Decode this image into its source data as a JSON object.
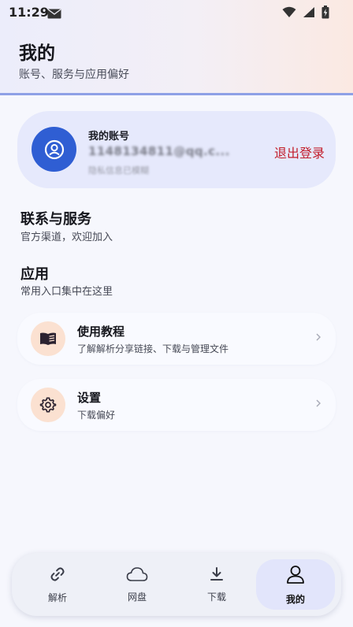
{
  "status_bar": {
    "time": "11:29",
    "mail_icon": "mail-icon",
    "wifi_icon": "wifi-icon",
    "signal_icon": "signal-icon",
    "battery_icon": "battery-charging-icon"
  },
  "header": {
    "title": "我的",
    "subtitle": "账号、服务与应用偏好"
  },
  "account": {
    "label": "我的账号",
    "email": "1148134811@qq.c...",
    "status": "隐私信息已模糊",
    "logout_label": "退出登录",
    "avatar_icon": "user-icon"
  },
  "sections": {
    "contact": {
      "title": "联系与服务",
      "subtitle": "官方渠道，欢迎加入"
    },
    "apps": {
      "title": "应用",
      "subtitle": "常用入口集中在这里"
    }
  },
  "items": [
    {
      "title": "使用教程",
      "subtitle": "了解解析分享链接、下载与管理文件",
      "icon": "book-icon"
    },
    {
      "title": "设置",
      "subtitle": "下载偏好",
      "icon": "gear-icon"
    }
  ],
  "nav": [
    {
      "label": "解析",
      "icon": "link-icon",
      "active": false
    },
    {
      "label": "网盘",
      "icon": "cloud-icon",
      "active": false
    },
    {
      "label": "下载",
      "icon": "download-icon",
      "active": false
    },
    {
      "label": "我的",
      "icon": "person-icon",
      "active": true
    }
  ],
  "colors": {
    "accent": "#2f5ed3",
    "danger": "#c21d2a",
    "icon_bg": "#fbe1d1",
    "card_bg": "#e6e9fc"
  }
}
